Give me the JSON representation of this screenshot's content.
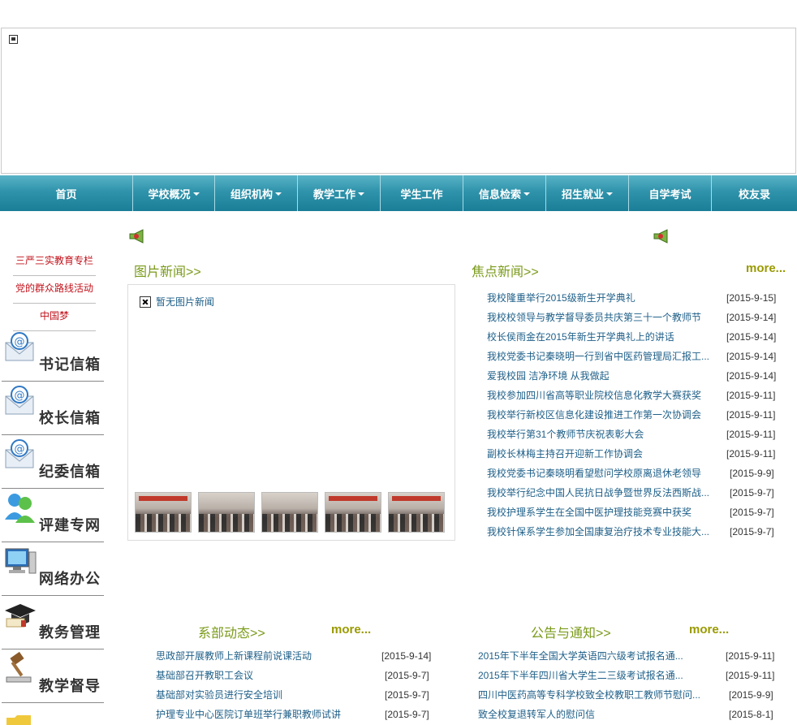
{
  "nav": {
    "items": [
      {
        "label": "首页",
        "dropdown": false
      },
      {
        "label": "学校概况",
        "dropdown": true
      },
      {
        "label": "组织机构",
        "dropdown": true
      },
      {
        "label": "教学工作",
        "dropdown": true
      },
      {
        "label": "学生工作",
        "dropdown": false
      },
      {
        "label": "信息检索",
        "dropdown": true
      },
      {
        "label": "招生就业",
        "dropdown": true
      },
      {
        "label": "自学考试",
        "dropdown": false
      },
      {
        "label": "校友录",
        "dropdown": false
      }
    ]
  },
  "side_links": [
    "三严三实教育专栏",
    "党的群众路线活动",
    "中国梦"
  ],
  "side_boxes": [
    {
      "label": "书记信箱",
      "icon": "mail-icon"
    },
    {
      "label": "校长信箱",
      "icon": "mail-icon"
    },
    {
      "label": "纪委信箱",
      "icon": "mail-icon"
    },
    {
      "label": "评建专网",
      "icon": "users-icon"
    },
    {
      "label": "网络办公",
      "icon": "computer-icon"
    },
    {
      "label": "教务管理",
      "icon": "graduation-cap-icon"
    },
    {
      "label": "教学督导",
      "icon": "gavel-icon"
    }
  ],
  "picture_news": {
    "title": "图片新闻>>",
    "empty_text": "暂无图片新闻"
  },
  "focus_news": {
    "title": "焦点新闻>>",
    "more": "more...",
    "items": [
      {
        "title": "我校隆重举行2015级新生开学典礼",
        "date": "[2015-9-15]"
      },
      {
        "title": "我校校领导与教学督导委员共庆第三十一个教师节",
        "date": "[2015-9-14]"
      },
      {
        "title": "校长侯雨金在2015年新生开学典礼上的讲话",
        "date": "[2015-9-14]"
      },
      {
        "title": "我校党委书记秦晓明一行到省中医药管理局汇报工...",
        "date": "[2015-9-14]"
      },
      {
        "title": "爱我校园  洁净环境  从我做起",
        "date": "[2015-9-14]"
      },
      {
        "title": "我校参加四川省高等职业院校信息化教学大赛获奖",
        "date": "[2015-9-11]"
      },
      {
        "title": "我校举行新校区信息化建设推进工作第一次协调会",
        "date": "[2015-9-11]"
      },
      {
        "title": "我校举行第31个教师节庆祝表彰大会",
        "date": "[2015-9-11]"
      },
      {
        "title": "副校长林梅主持召开迎新工作协调会",
        "date": "[2015-9-11]"
      },
      {
        "title": "我校党委书记秦晓明看望慰问学校原离退休老领导",
        "date": "[2015-9-9]"
      },
      {
        "title": "我校举行纪念中国人民抗日战争暨世界反法西斯战...",
        "date": "[2015-9-7]"
      },
      {
        "title": "我校护理系学生在全国中医护理技能竞赛中获奖",
        "date": "[2015-9-7]"
      },
      {
        "title": "我校针保系学生参加全国康复治疗技术专业技能大...",
        "date": "[2015-9-7]"
      }
    ]
  },
  "dept_news": {
    "title": "系部动态>>",
    "more": "more...",
    "items": [
      {
        "title": "思政部开展教师上新课程前说课活动",
        "date": "[2015-9-14]"
      },
      {
        "title": "基础部召开教职工会议",
        "date": "[2015-9-7]"
      },
      {
        "title": "基础部对实验员进行安全培训",
        "date": "[2015-9-7]"
      },
      {
        "title": "护理专业中心医院订单班举行兼职教师试讲",
        "date": "[2015-9-7]"
      }
    ]
  },
  "notices": {
    "title": "公告与通知>>",
    "more": "more...",
    "items": [
      {
        "title": "2015年下半年全国大学英语四六级考试报名通...",
        "date": "[2015-9-11]"
      },
      {
        "title": "2015年下半年四川省大学生二三级考试报名通...",
        "date": "[2015-9-11]"
      },
      {
        "title": "四川中医药高等专科学校致全校教职工教师节慰问...",
        "date": "[2015-9-9]"
      },
      {
        "title": "致全校复退转军人的慰问信",
        "date": "[2015-8-1]"
      }
    ]
  }
}
